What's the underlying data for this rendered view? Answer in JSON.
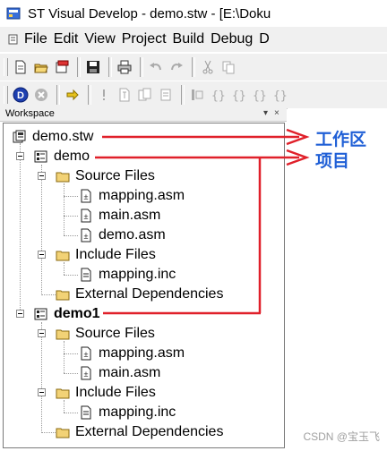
{
  "window": {
    "title": "ST Visual Develop - demo.stw - [E:\\Doku"
  },
  "menubar": {
    "items": [
      "File",
      "Edit",
      "View",
      "Project",
      "Build",
      "Debug",
      "D"
    ]
  },
  "toolbar1": {
    "icons": [
      "new-file-icon",
      "open-folder-icon",
      "open-workspace-icon",
      "save-icon",
      "print-icon",
      "undo-icon",
      "redo-icon",
      "cut-icon",
      "copy-icon"
    ]
  },
  "toolbar2": {
    "icons": [
      "debug-start-icon",
      "stop-icon",
      "run-arrow-icon",
      "break-icon",
      "compile-icon",
      "build-icon",
      "rebuild-icon",
      "stop-build-icon",
      "step-into-icon",
      "step-over-icon",
      "step-out-icon",
      "run-to-cursor-icon"
    ]
  },
  "workspace": {
    "header_label": "Workspace",
    "pin_symbol": "▾",
    "close_symbol": "×"
  },
  "tree": {
    "workspace_label": "demo.stw",
    "projects": [
      {
        "name": "demo",
        "source_folder": "Source Files",
        "source_files": [
          "mapping.asm",
          "main.asm",
          "demo.asm"
        ],
        "include_folder": "Include Files",
        "include_files": [
          "mapping.inc"
        ],
        "external_folder": "External Dependencies"
      },
      {
        "name": "demo1",
        "source_folder": "Source Files",
        "source_files": [
          "mapping.asm",
          "main.asm"
        ],
        "include_folder": "Include Files",
        "include_files": [
          "mapping.inc"
        ],
        "external_folder": "External Dependencies"
      }
    ]
  },
  "annotations": {
    "workspace_label": "工作区",
    "project_label": "项目",
    "arrow_color": "#e0202a",
    "label_color": "#1f5fd6"
  },
  "watermark": "CSDN @宝玉飞"
}
